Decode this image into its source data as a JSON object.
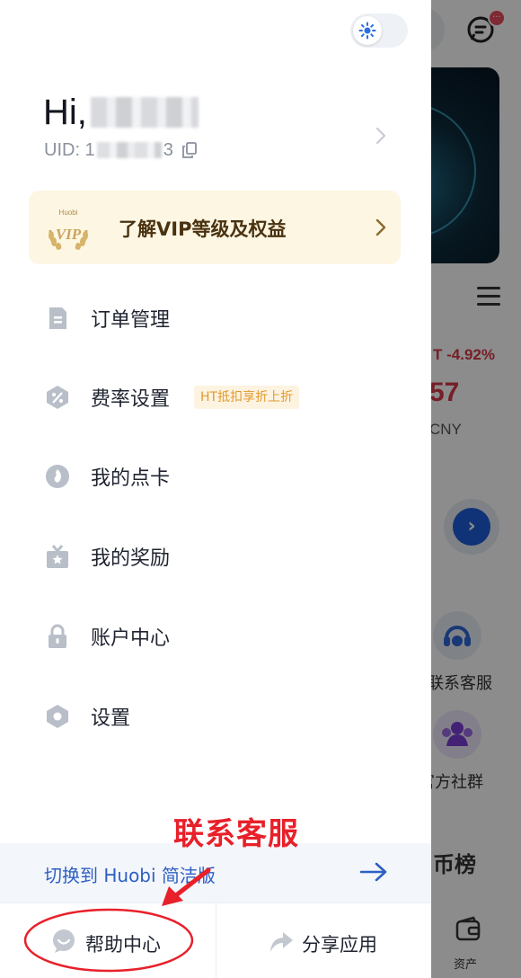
{
  "drawer": {
    "greeting": "Hi,",
    "uid_prefix": "UID: 1",
    "uid_suffix": "3",
    "vip": {
      "badge_text": "Huobi",
      "badge_mark": "VIP",
      "label": "了解VIP等级及权益"
    },
    "menu": [
      {
        "label": "订单管理",
        "icon": "order-icon"
      },
      {
        "label": "费率设置",
        "icon": "fee-icon",
        "tag": "HT抵扣享折上折"
      },
      {
        "label": "我的点卡",
        "icon": "point-card-icon"
      },
      {
        "label": "我的奖励",
        "icon": "gift-icon"
      },
      {
        "label": "账户中心",
        "icon": "lock-icon"
      },
      {
        "label": "设置",
        "icon": "settings-hexagon-icon"
      }
    ],
    "switch_bar": {
      "label": "切换到 Huobi 简洁版"
    },
    "bottom": {
      "help_label": "帮助中心",
      "share_label": "分享应用"
    }
  },
  "background": {
    "msg_badge": "···",
    "change_pct": "T -4.92%",
    "price_partial": "57",
    "currency_partial": "CNY",
    "customer_service": "联系客服",
    "community": "官方社群",
    "ranking_partial": "币榜",
    "assets_tab": "资产"
  },
  "annotation": {
    "label": "联系客服"
  },
  "colors": {
    "accent_blue": "#2d5fc4",
    "vip_bg": "#fdf6e3",
    "tag_orange": "#e39a2c",
    "annotation_red": "#e8202a",
    "drop_red": "#d53a4a"
  }
}
